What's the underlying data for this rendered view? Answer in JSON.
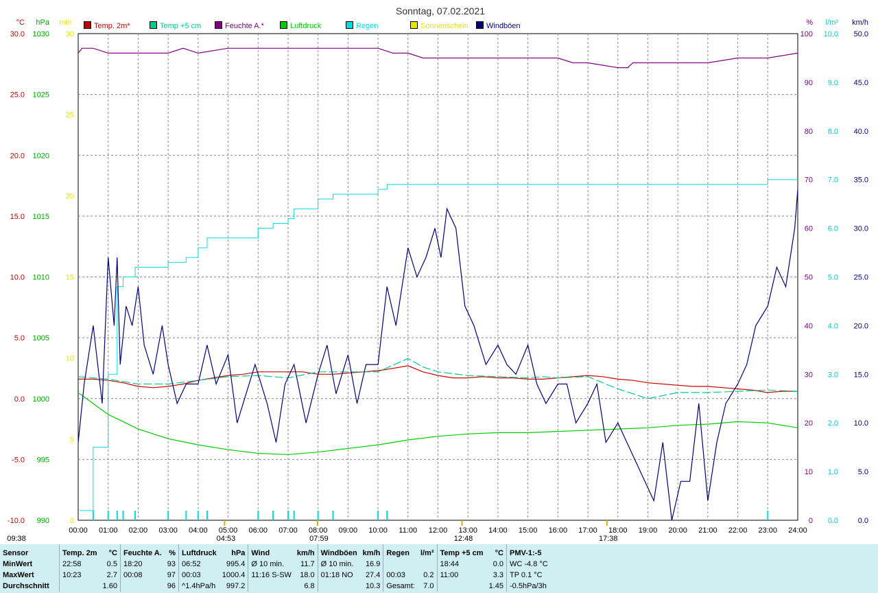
{
  "chart_data": {
    "type": "line",
    "title": "Sonntag, 07.02.2021",
    "x_labels": [
      "00:00",
      "01:00",
      "02:00",
      "03:00",
      "04:00",
      "05:00",
      "06:00",
      "07:00",
      "08:00",
      "09:00",
      "10:00",
      "11:00",
      "12:00",
      "13:00",
      "14:00",
      "15:00",
      "16:00",
      "17:00",
      "18:00",
      "19:00",
      "20:00",
      "21:00",
      "22:00",
      "23:00",
      "24:00"
    ],
    "axes": {
      "temp_c": {
        "label": "°C",
        "ticks": [
          "30.0",
          "25.0",
          "20.0",
          "15.0",
          "10.0",
          "5.0",
          "0.0",
          "-5.0",
          "-10.0"
        ],
        "range": [
          -10,
          30
        ],
        "color": "#cc0000"
      },
      "pressure_hpa": {
        "label": "hPa",
        "ticks": [
          "1030",
          "1025",
          "1020",
          "1015",
          "1010",
          "1005",
          "1000",
          "995",
          "990"
        ],
        "range": [
          990,
          1030
        ],
        "color": "#00aa00"
      },
      "sunshine_min": {
        "label": "min",
        "ticks": [
          "30",
          "25",
          "20",
          "15",
          "10",
          "5",
          "0"
        ],
        "range": [
          0,
          30
        ],
        "color": "#e6e600"
      },
      "humidity_pct": {
        "label": "%",
        "ticks": [
          "100",
          "90",
          "80",
          "70",
          "60",
          "50",
          "40",
          "30",
          "20",
          "10",
          "0"
        ],
        "range": [
          0,
          100
        ],
        "color": "#800080"
      },
      "rain_lm2": {
        "label": "l/m²",
        "ticks": [
          "10.0",
          "9.0",
          "8.0",
          "7.0",
          "6.0",
          "5.0",
          "4.0",
          "3.0",
          "2.0",
          "1.0",
          "0.0"
        ],
        "range": [
          0,
          10
        ],
        "color": "#00cccc"
      },
      "wind_kmh": {
        "label": "km/h",
        "ticks": [
          "50.0",
          "45.0",
          "40.0",
          "35.0",
          "30.0",
          "25.0",
          "20.0",
          "15.0",
          "10.0",
          "5.0",
          "0.0"
        ],
        "range": [
          0,
          50
        ],
        "color": "#000080"
      }
    },
    "series": [
      {
        "name": "Temp. 2m*",
        "color": "#cc0000",
        "axis": "temp_c",
        "x": [
          0,
          0.5,
          1,
          1.5,
          2,
          2.5,
          3,
          3.5,
          4,
          4.5,
          5,
          5.5,
          6,
          6.5,
          7,
          7.5,
          8,
          8.5,
          9,
          9.5,
          10,
          10.3,
          11,
          11.5,
          12,
          12.5,
          13,
          13.5,
          14,
          14.5,
          15,
          15.5,
          16,
          16.5,
          17,
          17.5,
          18,
          18.5,
          19,
          19.5,
          20,
          20.5,
          21,
          21.5,
          22,
          22.5,
          22.97,
          23.5,
          24
        ],
        "y": [
          1.6,
          1.6,
          1.5,
          1.3,
          1.0,
          0.9,
          1.0,
          1.2,
          1.5,
          1.7,
          1.9,
          2.0,
          2.2,
          2.2,
          2.2,
          2.2,
          2.0,
          2.0,
          2.1,
          2.2,
          2.3,
          2.4,
          2.7,
          2.2,
          1.9,
          1.7,
          1.7,
          1.8,
          1.7,
          1.7,
          1.6,
          1.6,
          1.7,
          1.8,
          1.9,
          1.8,
          1.6,
          1.5,
          1.3,
          1.2,
          1.1,
          1.0,
          1.0,
          0.9,
          0.8,
          0.7,
          0.5,
          0.6,
          0.6
        ]
      },
      {
        "name": "Temp +5 cm",
        "color": "#00cc88",
        "axis": "temp_c",
        "x": [
          0,
          1,
          2,
          3,
          4,
          5,
          6,
          7,
          8,
          9,
          10,
          11,
          11.5,
          12,
          13,
          14,
          15,
          15.5,
          16,
          17,
          18,
          19,
          20,
          21,
          22,
          23,
          24
        ],
        "y": [
          1.8,
          1.6,
          1.2,
          1.2,
          1.5,
          1.8,
          1.9,
          1.7,
          2.2,
          2.2,
          2.2,
          3.3,
          2.6,
          2.2,
          1.9,
          1.8,
          1.7,
          1.8,
          1.7,
          1.8,
          0.8,
          0.0,
          0.5,
          0.5,
          0.6,
          0.7,
          0.6
        ]
      },
      {
        "name": "Feuchte A.*",
        "color": "#800080",
        "axis": "humidity_pct",
        "x": [
          0,
          0.13,
          0.5,
          1,
          1.5,
          2,
          2.5,
          3,
          3.5,
          4,
          5,
          6,
          7,
          8,
          9,
          10,
          10.5,
          11,
          11.5,
          12,
          13,
          14,
          15,
          15.5,
          16,
          16.5,
          17,
          18,
          18.33,
          18.5,
          19,
          20,
          21,
          22,
          23,
          24
        ],
        "y": [
          96,
          97,
          97,
          96,
          96,
          96,
          96,
          96,
          97,
          96,
          97,
          97,
          97,
          97,
          97,
          97,
          96,
          96,
          95,
          95,
          95,
          95,
          95,
          95,
          95,
          94,
          94,
          93,
          93,
          94,
          94,
          94,
          94,
          95,
          95,
          96
        ]
      },
      {
        "name": "Luftdruck",
        "color": "#00cc00",
        "axis": "pressure_hpa",
        "x": [
          0,
          0.05,
          1,
          2,
          3,
          4,
          5,
          6,
          7,
          8,
          9,
          10,
          11,
          12,
          13,
          14,
          15,
          16,
          17,
          18,
          19,
          20,
          21,
          22,
          23,
          24
        ],
        "y": [
          1000.4,
          1000.4,
          998.7,
          997.5,
          996.7,
          996.2,
          995.8,
          995.5,
          995.4,
          995.6,
          995.9,
          996.2,
          996.6,
          996.9,
          997.1,
          997.2,
          997.2,
          997.3,
          997.4,
          997.5,
          997.6,
          997.8,
          997.9,
          998.1,
          998.0,
          997.6
        ]
      },
      {
        "name": "Regen",
        "color": "#00dddd",
        "axis": "rain_lm2",
        "x": [
          0.05,
          0.5,
          1.0,
          1.3,
          1.5,
          1.9,
          3.0,
          3.6,
          4.0,
          4.3,
          5.0,
          5.5,
          6.0,
          6.5,
          7.0,
          7.2,
          7.5,
          8.0,
          8.5,
          9.0,
          10.0,
          10.3,
          11.0,
          12.0,
          13.0,
          14.0,
          15.0,
          16.0,
          17.0,
          18.0,
          19.0,
          20.0,
          21.0,
          22.0,
          22.85,
          23.0,
          24
        ],
        "y": [
          0.2,
          1.5,
          3.0,
          4.8,
          5.0,
          5.2,
          5.3,
          5.4,
          5.6,
          5.8,
          5.8,
          5.8,
          6.0,
          6.1,
          6.2,
          6.4,
          6.4,
          6.6,
          6.7,
          6.7,
          6.8,
          6.9,
          6.9,
          6.9,
          6.9,
          6.9,
          6.9,
          6.9,
          6.9,
          6.9,
          6.9,
          6.9,
          6.9,
          6.9,
          6.9,
          7.0,
          7.0
        ]
      },
      {
        "name": "Sonnenschein",
        "color": "#e6e600",
        "axis": "sunshine_min",
        "x": [
          0,
          24
        ],
        "y": [
          0,
          0
        ]
      },
      {
        "name": "Windböen",
        "color": "#000080",
        "axis": "wind_kmh",
        "x": [
          0,
          0.2,
          0.5,
          0.8,
          1.0,
          1.2,
          1.3,
          1.4,
          1.6,
          1.8,
          2.0,
          2.2,
          2.5,
          2.8,
          3.0,
          3.3,
          3.6,
          4.0,
          4.3,
          4.6,
          5.0,
          5.3,
          5.6,
          5.9,
          6.3,
          6.6,
          6.9,
          7.2,
          7.6,
          8.0,
          8.3,
          8.6,
          9.0,
          9.3,
          9.6,
          10.0,
          10.3,
          10.6,
          11.0,
          11.3,
          11.6,
          11.9,
          12.1,
          12.3,
          12.6,
          12.9,
          13.2,
          13.6,
          14.0,
          14.3,
          14.6,
          15.0,
          15.3,
          15.6,
          16.0,
          16.3,
          16.6,
          17.0,
          17.3,
          17.6,
          18.0,
          18.3,
          18.6,
          18.9,
          19.2,
          19.5,
          19.8,
          20.1,
          20.4,
          20.7,
          21.0,
          21.3,
          21.6,
          22.0,
          22.3,
          22.6,
          23.0,
          23.3,
          23.6,
          23.9,
          24
        ],
        "y": [
          8,
          14,
          20,
          12,
          27,
          20,
          27,
          16,
          22,
          20,
          24,
          18,
          15,
          20,
          16,
          12,
          14,
          14,
          18,
          14,
          17,
          10,
          13,
          16,
          12,
          8,
          14,
          16,
          10,
          15,
          18,
          13,
          17,
          12,
          16,
          16,
          24,
          20,
          28,
          25,
          27,
          30,
          27,
          32,
          30,
          22,
          20,
          16,
          18,
          16,
          15,
          18,
          14,
          12,
          14,
          14,
          10,
          12,
          14,
          8,
          10,
          8,
          6,
          4,
          2,
          8,
          0,
          4,
          4,
          12,
          2,
          8,
          12,
          14,
          16,
          20,
          22,
          26,
          24,
          30,
          34
        ]
      }
    ],
    "sun_events": {
      "sunrise": "07:59",
      "noon": "12:48",
      "sunset": "17:38",
      "dawn": "04:53",
      "first": "09:38"
    }
  },
  "stats": {
    "headers": [
      {
        "sensor": "Sensor"
      },
      {
        "name": "Temp. 2m",
        "unit": "°C"
      },
      {
        "name": "Feuchte A.",
        "unit": "%"
      },
      {
        "name": "Luftdruck",
        "unit": "hPa"
      },
      {
        "name": "Wind",
        "unit": "km/h"
      },
      {
        "name": "Windböen",
        "unit": "km/h"
      },
      {
        "name": "Regen",
        "unit": "l/m²"
      },
      {
        "name": "Temp +5 cm",
        "unit": "°C"
      },
      {
        "name": "PMV-1:-5",
        "unit": ""
      }
    ],
    "rows": [
      {
        "label": "MinWert",
        "cells": [
          [
            "22:58",
            "0.5"
          ],
          [
            "18:20",
            "93"
          ],
          [
            "06:52",
            "995.4"
          ],
          [
            "Ø 10 min.",
            "11.7"
          ],
          [
            "Ø 10 min.",
            "16.9"
          ],
          [
            "",
            ""
          ],
          [
            "18:44",
            "0.0"
          ],
          [
            "WC -4.8 °C",
            ""
          ]
        ]
      },
      {
        "label": "MaxWert",
        "cells": [
          [
            "10:23",
            "2.7"
          ],
          [
            "00:08",
            "97"
          ],
          [
            "00:03",
            "1000.4"
          ],
          [
            "11:16 S-SW",
            "18.0"
          ],
          [
            "01:18 NO",
            "27.4"
          ],
          [
            "00:03",
            "0.2"
          ],
          [
            "11:00",
            "3.3"
          ],
          [
            "TP 0.1 °C",
            ""
          ]
        ]
      },
      {
        "label": "Durchschnitt",
        "cells": [
          [
            "",
            "1.60"
          ],
          [
            "",
            "96"
          ],
          [
            "^1.4hPa/h",
            "997.2"
          ],
          [
            "",
            "6.8"
          ],
          [
            "",
            "10.3"
          ],
          [
            "Gesamt:",
            "7.0"
          ],
          [
            "",
            "1.45"
          ],
          [
            "-0.5hPa/3h",
            ""
          ]
        ]
      }
    ]
  }
}
